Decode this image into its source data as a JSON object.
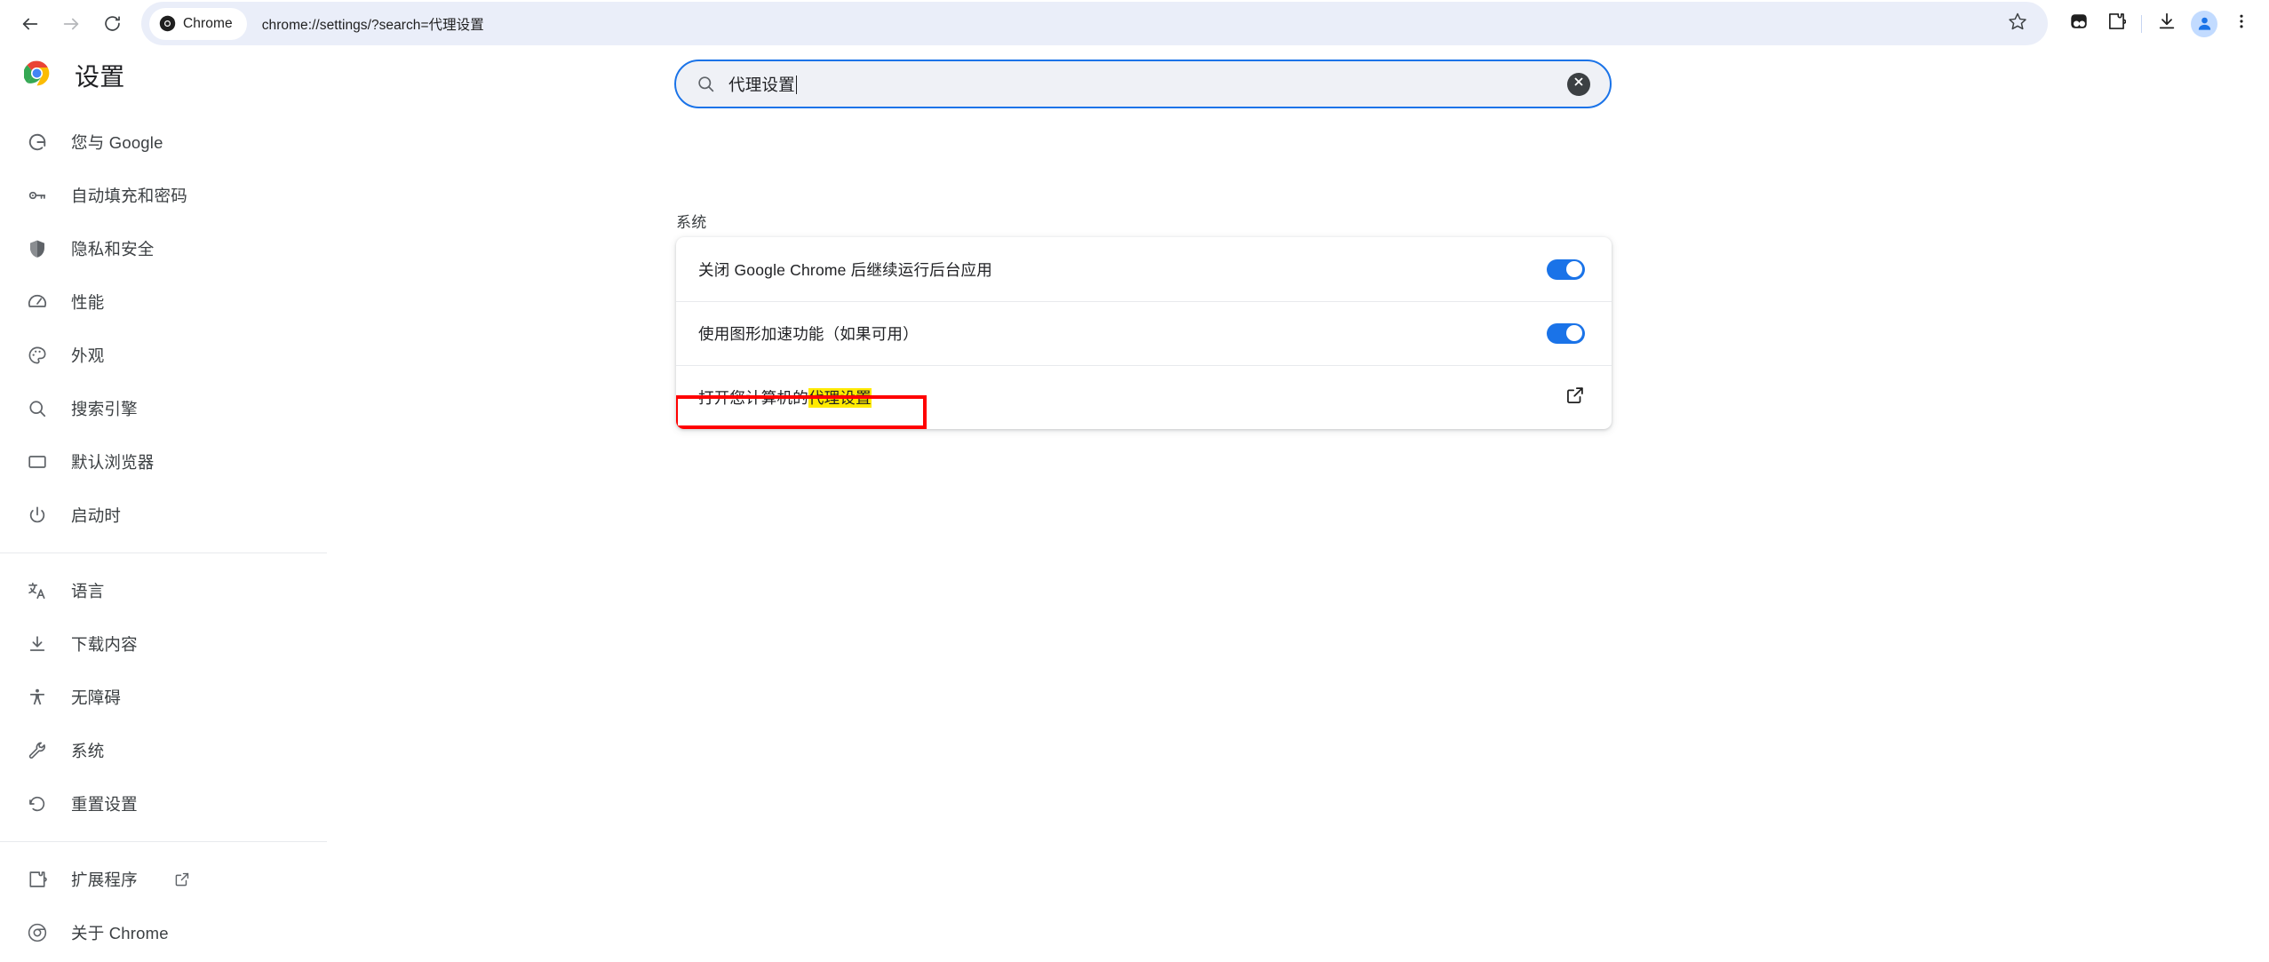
{
  "browser": {
    "back_icon": "back-arrow-icon",
    "forward_icon": "forward-arrow-icon",
    "reload_icon": "reload-icon",
    "chip_label": "Chrome",
    "url": "chrome://settings/?search=代理设置",
    "star_icon": "bookmark-star-icon",
    "toolbar_icons": [
      {
        "name": "split-view-icon"
      },
      {
        "name": "extensions-puzzle-icon"
      },
      {
        "name": "downloads-icon"
      },
      {
        "name": "profile-avatar-icon"
      },
      {
        "name": "three-dot-menu-icon"
      }
    ]
  },
  "sidebar": {
    "logo": "chrome-logo-icon",
    "title": "设置",
    "groups": [
      {
        "items": [
          {
            "label": "您与 Google",
            "icon": "google-g-icon"
          },
          {
            "label": "自动填充和密码",
            "icon": "key-icon"
          },
          {
            "label": "隐私和安全",
            "icon": "shield-icon"
          },
          {
            "label": "性能",
            "icon": "speedometer-icon"
          },
          {
            "label": "外观",
            "icon": "palette-icon"
          },
          {
            "label": "搜索引擎",
            "icon": "search-icon"
          },
          {
            "label": "默认浏览器",
            "icon": "browser-window-icon"
          },
          {
            "label": "启动时",
            "icon": "power-icon"
          }
        ]
      },
      {
        "items": [
          {
            "label": "语言",
            "icon": "translate-icon"
          },
          {
            "label": "下载内容",
            "icon": "download-icon"
          },
          {
            "label": "无障碍",
            "icon": "accessibility-icon"
          },
          {
            "label": "系统",
            "icon": "wrench-icon"
          },
          {
            "label": "重置设置",
            "icon": "restore-icon"
          }
        ]
      },
      {
        "items": [
          {
            "label": "扩展程序",
            "icon": "puzzle-icon",
            "external": true
          },
          {
            "label": "关于 Chrome",
            "icon": "chrome-logo-icon"
          }
        ]
      }
    ]
  },
  "search": {
    "icon": "search-icon",
    "value": "代理设置",
    "clear_icon": "clear-circle-icon"
  },
  "main": {
    "section_title": "系统",
    "rows": [
      {
        "label": "关闭 Google Chrome 后继续运行后台应用",
        "control": "toggle",
        "toggle_on": true
      },
      {
        "label": "使用图形加速功能（如果可用）",
        "control": "toggle",
        "toggle_on": true
      },
      {
        "label_prefix": "打开您计算机的",
        "label_highlight": "代理设置",
        "control": "external-link",
        "annotated": true
      }
    ]
  },
  "colors": {
    "accent_blue": "#1a73e8",
    "omnibox_bg": "#eaeef9",
    "highlight_yellow": "#ffea00",
    "annotation_red": "#ff0000",
    "text_primary": "#202124",
    "text_secondary": "#3c4043"
  }
}
